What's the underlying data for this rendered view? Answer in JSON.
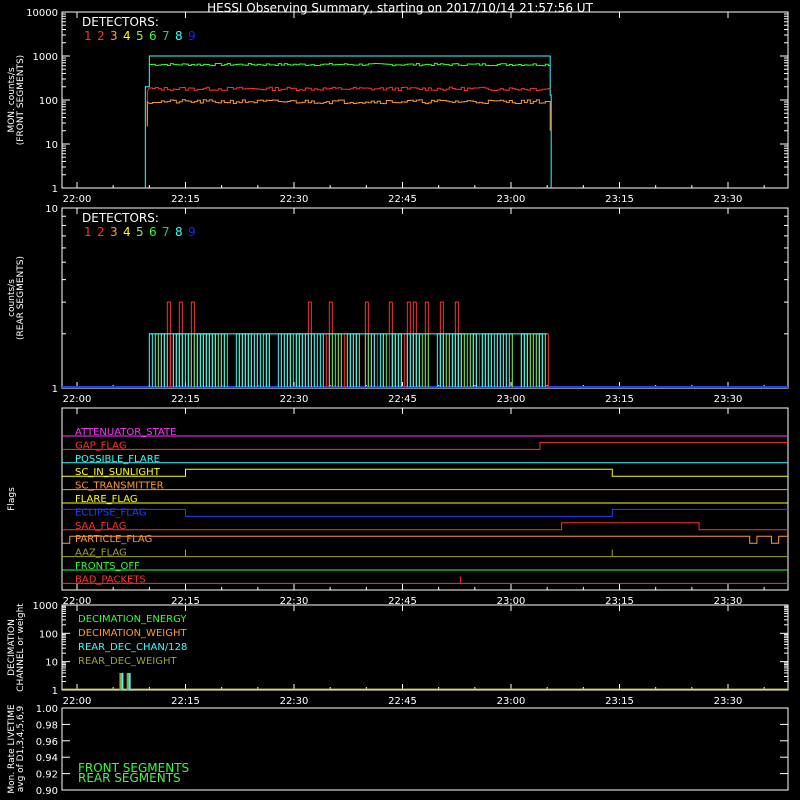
{
  "title": "HESSI Observing Summary, starting on 2017/10/14 21:57:56 UT",
  "colors": {
    "background": "#000000",
    "axes": "#ffffff",
    "det": [
      "#ff3030",
      "#ff3030",
      "#ff9933",
      "#ffff00",
      "#a0e040",
      "#33ff33",
      "#20c0a0",
      "#33ffff",
      "#2020ff"
    ],
    "front_bg_red": "#ff3030",
    "front_orange": "#ff9933",
    "front_green": "#33ff33",
    "front_cyan": "#33ffff",
    "rear_green": "#55ee55",
    "rear_cyan": "#33ffff",
    "rear_red": "#ff3030",
    "rear_blue": "#2040ff",
    "magenta": "#ff33ff",
    "yellow": "#ffff00",
    "olive": "#a0a030",
    "green": "#33ff33",
    "red": "#ff3030",
    "orange": "#ff9933",
    "blue": "#2040ff"
  },
  "chart_data": [
    {
      "id": "front",
      "type": "line",
      "ylabel": "MON. counts/s\n(FRONT SEGMENTS)",
      "xlim": [
        "22:00",
        "23:39"
      ],
      "ylim": [
        1,
        10000
      ],
      "yscale": "log",
      "x_ticks": [
        "22:00",
        "22:15",
        "22:30",
        "22:45",
        "23:00",
        "23:15",
        "23:30"
      ],
      "y_ticks": [
        "1",
        "10",
        "100",
        "1000",
        "10000"
      ],
      "legend_title": "DETECTORS:",
      "legend_items": [
        "1",
        "2",
        "3",
        "4",
        "5",
        "6",
        "7",
        "8",
        "9"
      ],
      "series": [
        {
          "color_key": "front_cyan",
          "x": [
            "22:08",
            "22:10",
            "23:05",
            "23:06"
          ],
          "values": [
            1,
            1000,
            1000,
            1
          ]
        },
        {
          "color_key": "front_green",
          "x": [
            "22:10",
            "22:20",
            "22:40",
            "23:05"
          ],
          "values": [
            620,
            650,
            640,
            630
          ]
        },
        {
          "color_key": "front_bg_red",
          "x": [
            "22:10",
            "22:20",
            "22:40",
            "23:05"
          ],
          "values": [
            160,
            180,
            190,
            180
          ]
        },
        {
          "color_key": "front_orange",
          "x": [
            "22:10",
            "22:20",
            "22:40",
            "23:05"
          ],
          "values": [
            90,
            95,
            85,
            100
          ]
        }
      ]
    },
    {
      "id": "rear",
      "type": "line",
      "ylabel": "counts/s\n(REAR SEGMENTS)",
      "xlim": [
        "22:00",
        "23:39"
      ],
      "ylim": [
        1,
        10
      ],
      "yscale": "log",
      "x_ticks": [
        "22:00",
        "22:15",
        "22:30",
        "22:45",
        "23:00",
        "23:15",
        "23:30"
      ],
      "y_ticks": [
        "1",
        "10"
      ],
      "legend_title": "DETECTORS:",
      "legend_items": [
        "1",
        "2",
        "3",
        "4",
        "5",
        "6",
        "7",
        "8",
        "9"
      ],
      "baseline": 1,
      "level_low": 2,
      "level_high": 3,
      "x_start": "22:10",
      "x_end": "23:05"
    },
    {
      "id": "flags",
      "type": "line",
      "ylabel": "Flags",
      "xlim": [
        "22:00",
        "23:39"
      ],
      "x_ticks": [
        "22:00",
        "22:15",
        "22:30",
        "22:45",
        "23:00",
        "23:15",
        "23:30"
      ],
      "flags": [
        {
          "label": "ATTENUATOR_STATE",
          "color_key": "magenta",
          "steps": [
            [
              "21:58",
              0
            ],
            [
              "23:39",
              0
            ]
          ]
        },
        {
          "label": "GAP_FLAG",
          "color_key": "red",
          "steps": [
            [
              "21:58",
              0
            ],
            [
              "23:04",
              1
            ],
            [
              "23:39",
              1
            ]
          ]
        },
        {
          "label": "POSSIBLE_FLARE",
          "color_key": "front_cyan",
          "steps": [
            [
              "21:58",
              0
            ],
            [
              "23:39",
              0
            ]
          ]
        },
        {
          "label": "SC_IN_SUNLIGHT",
          "color_key": "yellow",
          "steps": [
            [
              "21:58",
              0
            ],
            [
              "22:15",
              1
            ],
            [
              "23:14",
              0
            ],
            [
              "23:39",
              0
            ]
          ]
        },
        {
          "label": "SC_TRANSMITTER",
          "color_key": "orange",
          "steps": [
            [
              "21:58",
              0
            ],
            [
              "23:39",
              0
            ]
          ]
        },
        {
          "label": "FLARE_FLAG",
          "color_key": "yellow",
          "steps": [
            [
              "21:58",
              0
            ],
            [
              "23:39",
              0
            ]
          ]
        },
        {
          "label": "ECLIPSE_FLAG",
          "color_key": "blue",
          "steps": [
            [
              "21:58",
              1
            ],
            [
              "22:15",
              0
            ],
            [
              "23:14",
              1
            ],
            [
              "23:39",
              1
            ]
          ]
        },
        {
          "label": "SAA_FLAG",
          "color_key": "red",
          "steps": [
            [
              "21:58",
              0
            ],
            [
              "23:07",
              1
            ],
            [
              "23:26",
              0
            ],
            [
              "23:39",
              0
            ]
          ]
        },
        {
          "label": "PARTICLE_FLAG",
          "color_key": "orange",
          "steps": [
            [
              "21:58",
              0
            ],
            [
              "21:59",
              1
            ],
            [
              "23:33",
              0
            ],
            [
              "23:34",
              1
            ],
            [
              "23:36",
              0
            ],
            [
              "23:37",
              1
            ],
            [
              "23:39",
              1
            ]
          ]
        },
        {
          "label": "AAZ_FLAG",
          "color_key": "olive",
          "steps": [
            [
              "21:58",
              0
            ],
            [
              "22:15",
              1
            ],
            [
              "22:15",
              0
            ],
            [
              "23:14",
              1
            ],
            [
              "23:14",
              0
            ],
            [
              "23:39",
              0
            ]
          ]
        },
        {
          "label": "FRONTS_OFF",
          "color_key": "green",
          "steps": [
            [
              "21:58",
              0
            ],
            [
              "23:39",
              0
            ]
          ]
        },
        {
          "label": "BAD_PACKETS",
          "color_key": "red",
          "steps": [
            [
              "21:58",
              0
            ],
            [
              "22:53",
              1
            ],
            [
              "22:53",
              0
            ],
            [
              "23:39",
              0
            ]
          ]
        }
      ]
    },
    {
      "id": "decimation",
      "type": "line",
      "ylabel": "DECIMATION\nCHANNEL or weight",
      "xlim": [
        "22:00",
        "23:39"
      ],
      "ylim": [
        1,
        1000
      ],
      "yscale": "log",
      "x_ticks": [
        "22:00",
        "22:15",
        "22:30",
        "22:45",
        "23:00",
        "23:15",
        "23:30"
      ],
      "y_ticks": [
        "1",
        "10",
        "100",
        "1000"
      ],
      "legend": [
        {
          "label": "DECIMATION_ENERGY",
          "color_key": "green"
        },
        {
          "label": "DECIMATION_WEIGHT",
          "color_key": "orange"
        },
        {
          "label": "REAR_DEC_CHAN/128",
          "color_key": "front_cyan"
        },
        {
          "label": "REAR_DEC_WEIGHT",
          "color_key": "olive"
        }
      ],
      "spikes": [
        {
          "x": "22:06",
          "value": 4,
          "color_key": "olive"
        },
        {
          "x": "22:06",
          "value": 4,
          "color_key": "front_cyan"
        },
        {
          "x": "22:07",
          "value": 4,
          "color_key": "olive"
        },
        {
          "x": "22:07",
          "value": 4,
          "color_key": "front_cyan"
        }
      ]
    },
    {
      "id": "livetime",
      "type": "line",
      "ylabel": "Mon. Rate LIVETIME\navg of D1,3,4,5,6,9",
      "ylim": [
        0.9,
        1.0
      ],
      "y_ticks": [
        "0.90",
        "0.92",
        "0.94",
        "0.96",
        "0.98",
        "1.00"
      ],
      "legend": [
        {
          "label": "FRONT SEGMENTS",
          "color_key": "green"
        },
        {
          "label": "REAR SEGMENTS",
          "color_key": "rear_green"
        }
      ]
    }
  ]
}
